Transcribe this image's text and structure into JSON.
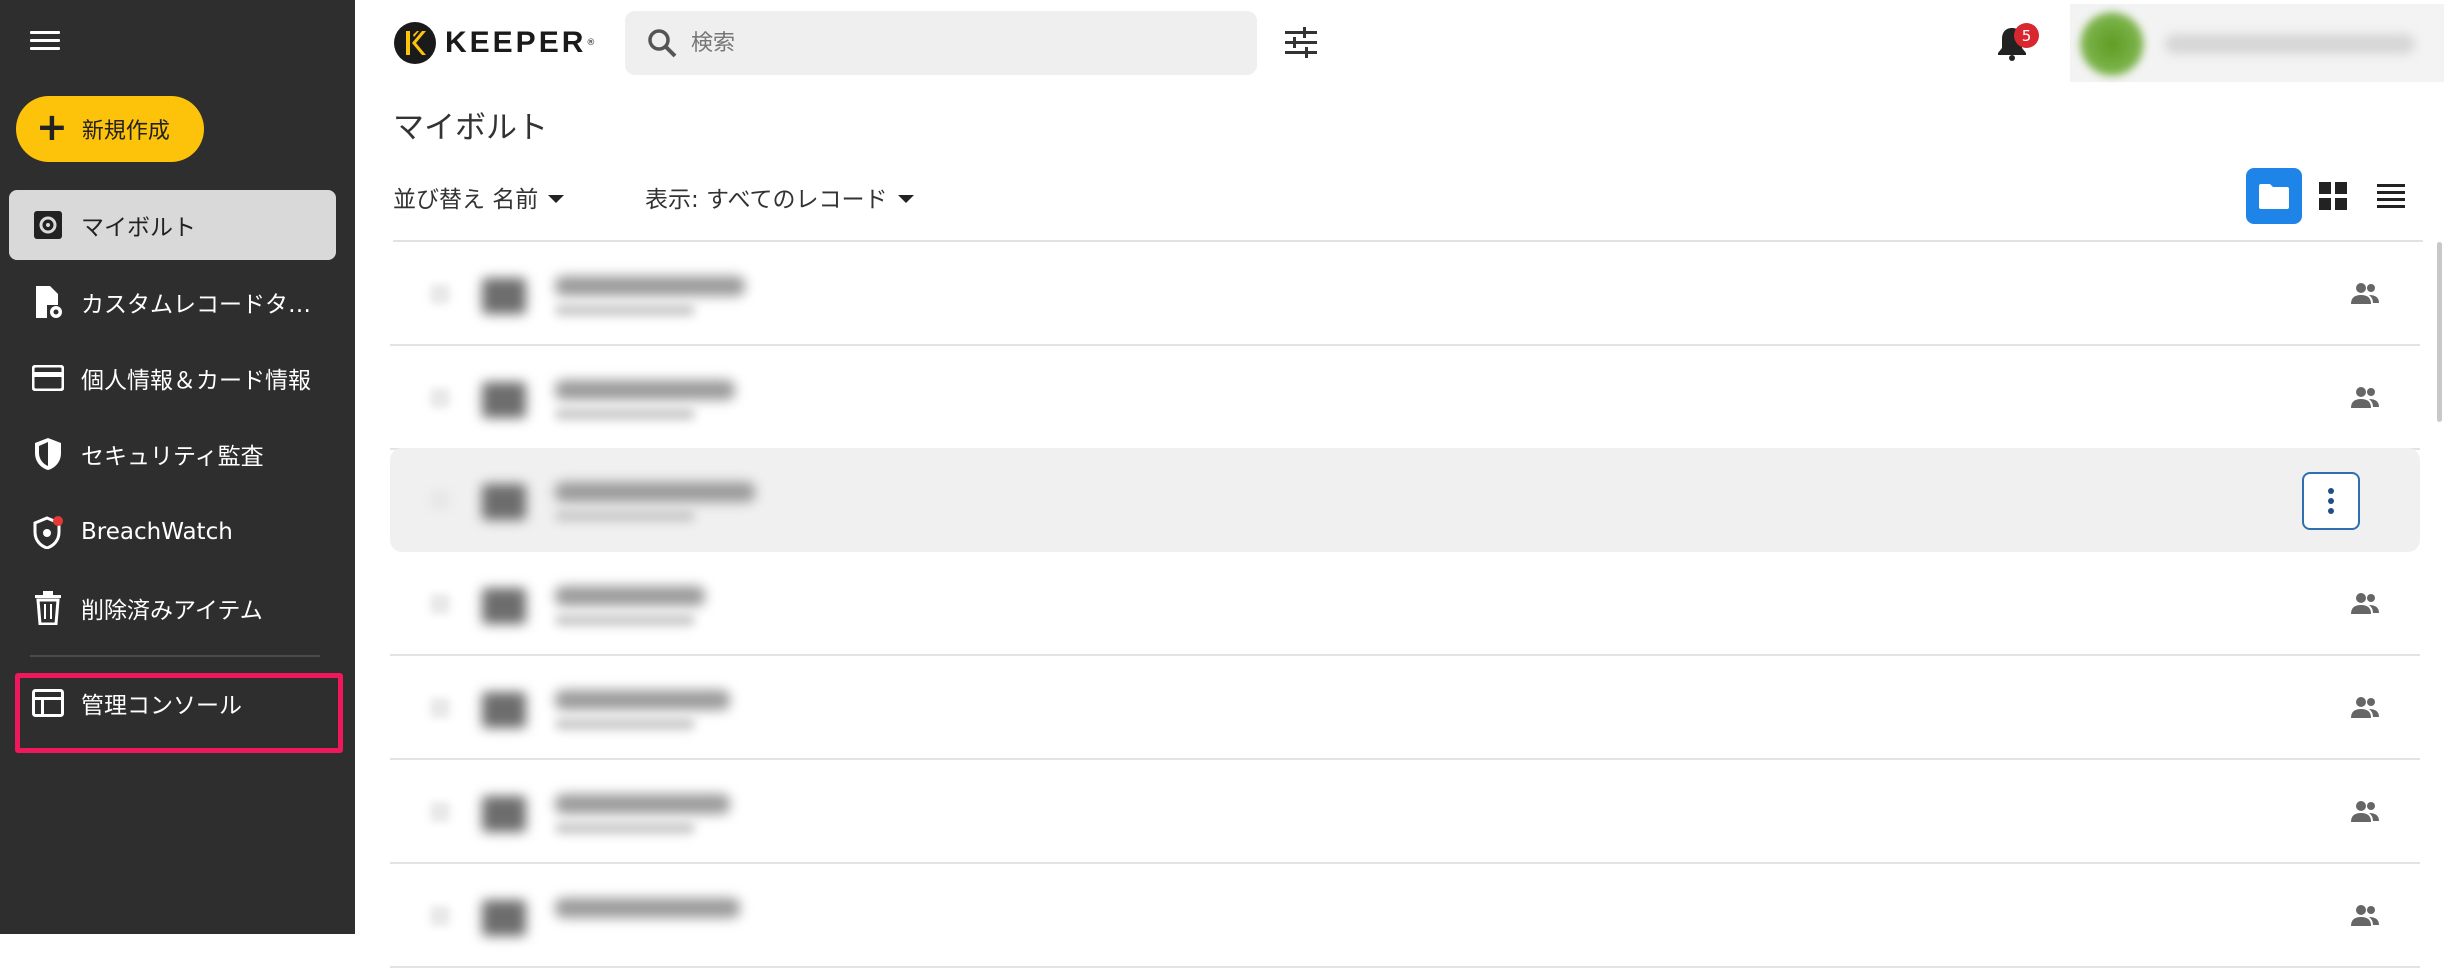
{
  "sidebar": {
    "new_button": "新規作成",
    "items": [
      {
        "label": "マイボルト",
        "icon": "vault-icon"
      },
      {
        "label": "カスタムレコードタイプ",
        "icon": "custom-record-icon"
      },
      {
        "label": "個人情報＆カード情報",
        "icon": "card-icon"
      },
      {
        "label": "セキュリティ監査",
        "icon": "shield-icon"
      },
      {
        "label": "BreachWatch",
        "icon": "breachwatch-icon"
      },
      {
        "label": "削除済みアイテム",
        "icon": "trash-icon"
      },
      {
        "label": "管理コンソール",
        "icon": "admin-console-icon"
      }
    ]
  },
  "header": {
    "logo_text": "KEEPER",
    "search_placeholder": "検索",
    "notification_count": "5"
  },
  "main": {
    "title": "マイボルト",
    "sort_label": "並び替え 名前",
    "view_label": "表示: すべてのレコード"
  },
  "colors": {
    "sidebar_bg": "#2e2e2e",
    "accent_yellow": "#fdc30a",
    "active_view": "#1f84e8",
    "highlight_box": "#f0185d",
    "badge": "#d8272f"
  }
}
